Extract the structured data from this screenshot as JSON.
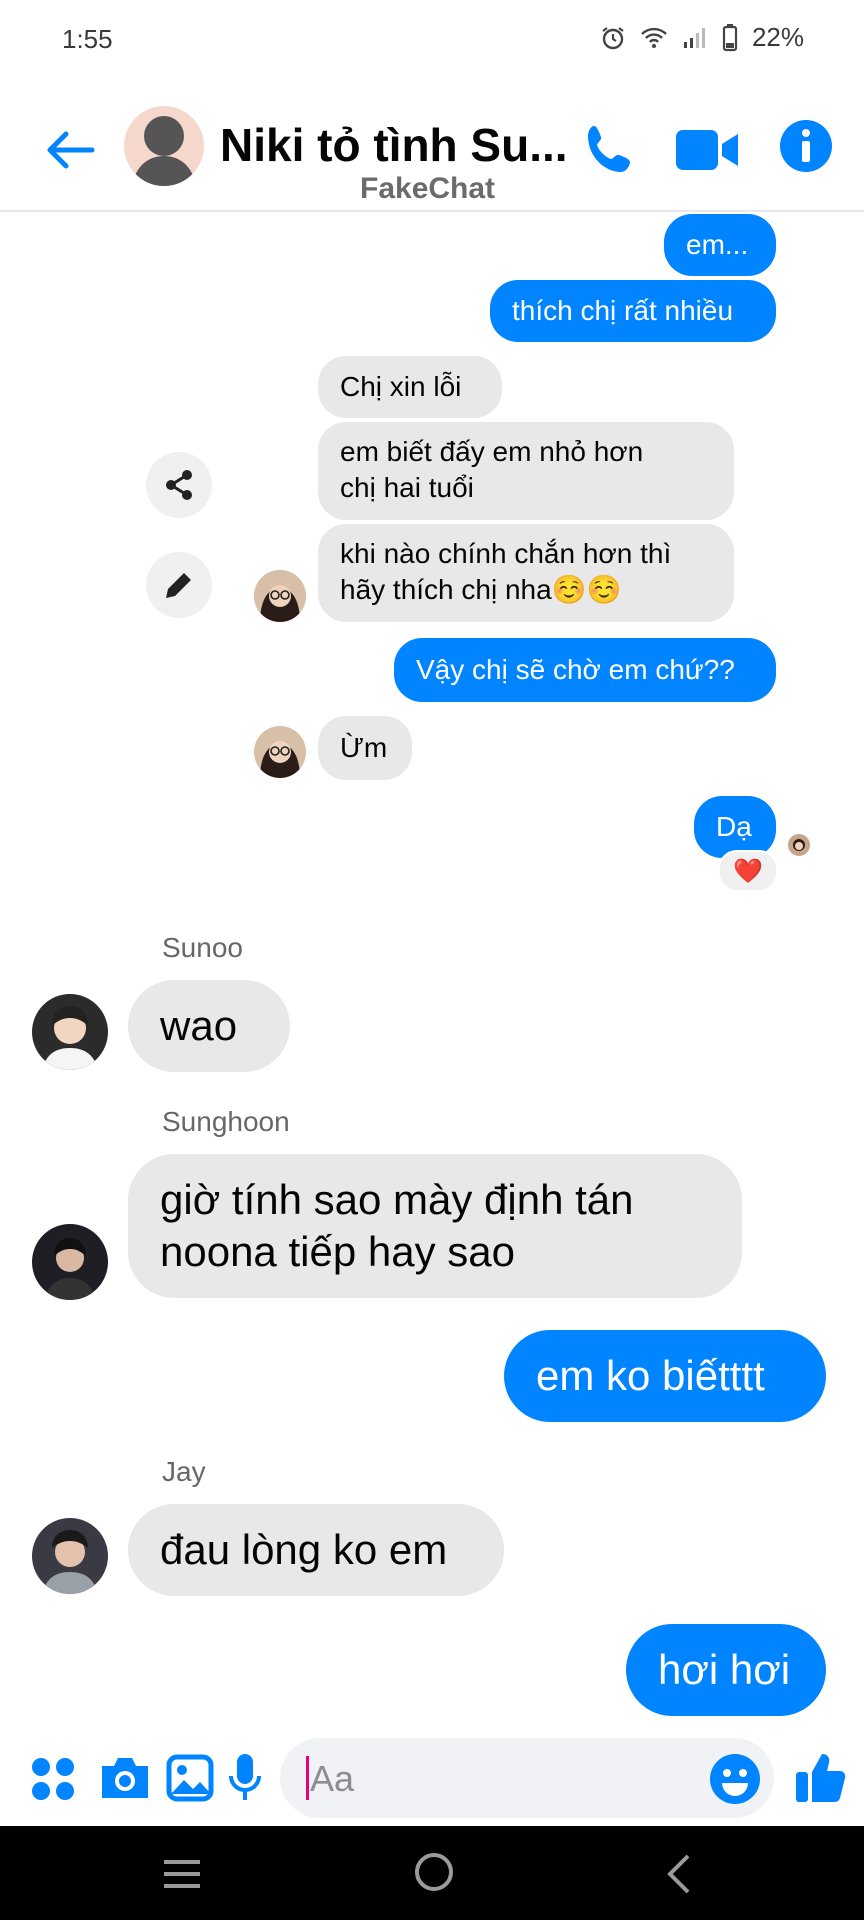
{
  "status_bar": {
    "time": "1:55",
    "battery": "22%"
  },
  "header": {
    "title": "Niki tỏ tình Su...",
    "watermark": "FakeChat"
  },
  "messages": {
    "m1": "em...",
    "m2": "thích chị rất nhiều",
    "m3": "Chị xin lỗi",
    "m4a": "em biết đấy em nhỏ hơn",
    "m4b": "chị hai tuổi",
    "m5a": "khi nào chính chắn hơn thì",
    "m5b": "hãy thích chị nha☺️☺️",
    "m6": "Vậy chị sẽ chờ em chứ??",
    "m7": "Ừm",
    "m8": "Dạ",
    "m8_reaction": "❤️",
    "sunoo_name": "Sunoo",
    "m9": "wao",
    "sunghoon_name": "Sunghoon",
    "m10a": "giờ tính sao mày định tán",
    "m10b": "noona tiếp hay sao",
    "m11": "em ko biếtttt",
    "jay_name": "Jay",
    "m12": "đau lòng ko em",
    "m13": "hơi hơi"
  },
  "composer": {
    "placeholder": "Aa"
  },
  "colors": {
    "accent": "#0084ff",
    "incoming": "#e8e8e9"
  }
}
